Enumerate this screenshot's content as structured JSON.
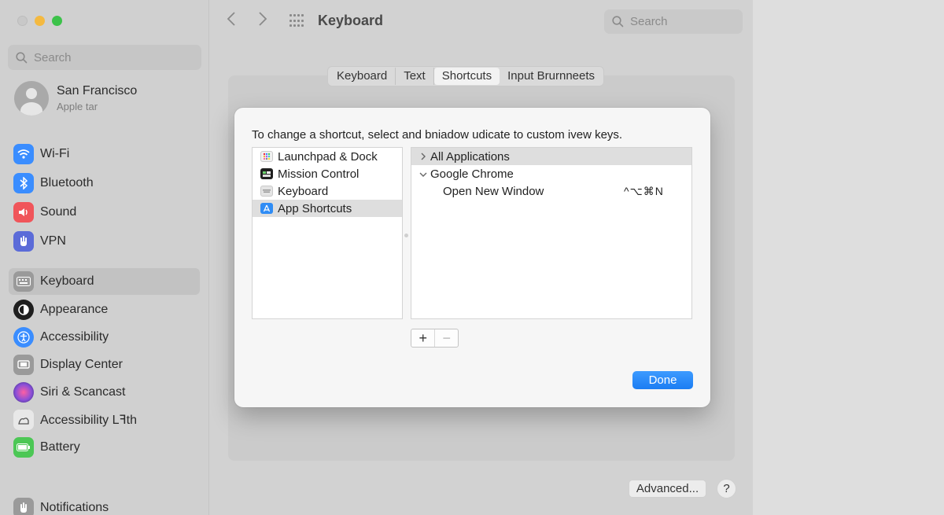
{
  "window": {
    "title": "Keyboard"
  },
  "sidebar": {
    "search_placeholder": "Search",
    "account": {
      "name": "San Francisco",
      "subtitle": "Apple tar"
    },
    "items": [
      {
        "label": "Wi-Fi",
        "icon": "wifi-icon",
        "color": "#3a8dff"
      },
      {
        "label": "Bluetooth",
        "icon": "bluetooth-icon",
        "color": "#3a8dff"
      },
      {
        "label": "Sound",
        "icon": "sound-icon",
        "color": "#f0555a"
      },
      {
        "label": "VPN",
        "icon": "hand-icon",
        "color": "#5b6bd8"
      },
      {
        "label": "Keyboard",
        "icon": "keyboard-icon",
        "color": "#9a9a9a",
        "active": true
      },
      {
        "label": "Appearance",
        "icon": "appearance-icon",
        "color": "#1f1f1f"
      },
      {
        "label": "Accessibility",
        "icon": "accessibility-icon",
        "color": "#3a8dff"
      },
      {
        "label": "Display Center",
        "icon": "display-icon",
        "color": "#9a9a9a"
      },
      {
        "label": "Siri & Scancast",
        "icon": "siri-icon",
        "color": "#8a4fd8"
      },
      {
        "label": "Accessibility Lꟻth",
        "icon": "hand-wave-icon",
        "color": "#e8e8e8"
      },
      {
        "label": "Battery",
        "icon": "battery-icon",
        "color": "#4cc755"
      },
      {
        "label": "Notifications",
        "icon": "notifications-icon",
        "color": "#9a9a9a"
      }
    ]
  },
  "toolbar": {
    "title": "Keyboard",
    "search_placeholder": "Search"
  },
  "tabs": [
    {
      "label": "Keyboard",
      "selected": false
    },
    {
      "label": "Text",
      "selected": false
    },
    {
      "label": "Shortcuts",
      "selected": true
    },
    {
      "label": "Input Brurnneets",
      "selected": false
    }
  ],
  "dialog": {
    "instruction": "To change a shortcut, select and bniadow udicate to custom ivew keys.",
    "categories": [
      {
        "label": "Launchpad & Dock",
        "icon": "launchpad-icon"
      },
      {
        "label": "Mission Control",
        "icon": "mission-control-icon"
      },
      {
        "label": "Keyboard",
        "icon": "keyboard-icon"
      },
      {
        "label": "App Shortcuts",
        "icon": "app-store-icon",
        "selected": true
      }
    ],
    "shortcuts": {
      "all_applications": "All Applications",
      "group": "Google Chrome",
      "item": "Open New Window",
      "key": "^⌥⌘N"
    },
    "add_label": "+",
    "remove_label": "−",
    "done_label": "Done"
  },
  "footer": {
    "advanced_label": "Advanced...",
    "help_label": "?"
  }
}
